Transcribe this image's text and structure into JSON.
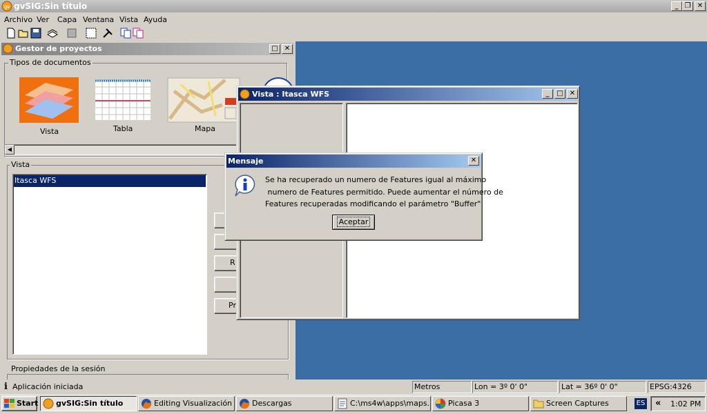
{
  "app": {
    "title": "gvSIG:Sin título"
  },
  "menu": [
    "Archivo",
    "Ver",
    "Capa",
    "Ventana",
    "Vista",
    "Ayuda"
  ],
  "project_manager": {
    "title": "Gestor de proyectos",
    "doc_types_label": "Tipos de documentos",
    "doc_types": [
      "Vista",
      "Tabla",
      "Mapa"
    ],
    "list_group_label": "Vista",
    "items": [
      "Itasca WFS"
    ],
    "side_buttons": [
      "",
      "",
      "R",
      "",
      "Pr"
    ],
    "session_label": "Propiedades de la sesión"
  },
  "view_window": {
    "title": "Vista : Itasca WFS"
  },
  "dialog": {
    "title": "Mensaje",
    "lines": [
      "Se ha recuperado un numero de Features igual al máximo",
      " numero de Features permitido. Puede aumentar el número de",
      "Features recuperadas modificando el parámetro \"Buffer\""
    ],
    "accept": "Aceptar"
  },
  "status": {
    "message": "Aplicación iniciada",
    "units": "Metros",
    "lon": "Lon = 3º 0' 0\"",
    "lat": "Lat = 36º 0' 0\"",
    "epsg": "EPSG:4326"
  },
  "taskbar": {
    "start": "Start",
    "tasks": [
      "gvSIG:Sin título",
      "Editing Visualización ...",
      "Descargas",
      "C:\\ms4w\\apps\\maps...",
      "Picasa 3",
      "Screen Captures"
    ],
    "lang": "ES",
    "chevron": "«",
    "clock": "1:02 PM"
  },
  "colors": {
    "desktop": "#3a6ea5",
    "title_active": "#0a246a",
    "title_gradient_end": "#a6caf0"
  }
}
